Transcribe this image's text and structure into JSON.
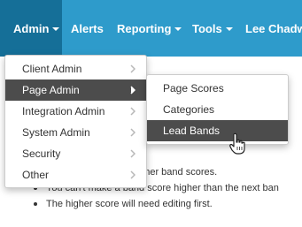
{
  "nav": {
    "items": [
      {
        "label": "Admin",
        "has_caret": true,
        "active": true
      },
      {
        "label": "Alerts",
        "has_caret": false,
        "active": false
      },
      {
        "label": "Reporting",
        "has_caret": true,
        "active": false
      },
      {
        "label": "Tools",
        "has_caret": true,
        "active": false
      },
      {
        "label": "Lee Chadwic",
        "has_caret": false,
        "active": false
      }
    ]
  },
  "admin_menu": {
    "items": [
      {
        "label": "Client Admin",
        "active": false,
        "icon": "chevron-right-icon"
      },
      {
        "label": "Page Admin",
        "active": true,
        "icon": "chevron-right-icon"
      },
      {
        "label": "Integration Admin",
        "active": false,
        "icon": "chevron-right-icon"
      },
      {
        "label": "System Admin",
        "active": false,
        "icon": "chevron-right-icon"
      },
      {
        "label": "Security",
        "active": false,
        "icon": "chevron-right-icon"
      },
      {
        "label": "Other",
        "active": false,
        "icon": "chevron-right-icon"
      }
    ]
  },
  "page_admin_submenu": {
    "items": [
      {
        "label": "Page Scores",
        "active": false
      },
      {
        "label": "Categories",
        "active": false
      },
      {
        "label": "Lead Bands",
        "active": true
      }
    ]
  },
  "content": {
    "line_1_visible": "d to edit the higher band scores.",
    "bullets": [
      "You can't make a band score higher than the next ban",
      "The higher score will need editing first."
    ]
  },
  "colors": {
    "nav_background": "#2e9bcb",
    "nav_active_background": "#156f98",
    "menu_highlight": "#4c4c4c",
    "menu_text": "#333333"
  },
  "cursor": {
    "icon": "hand-pointer-icon"
  }
}
